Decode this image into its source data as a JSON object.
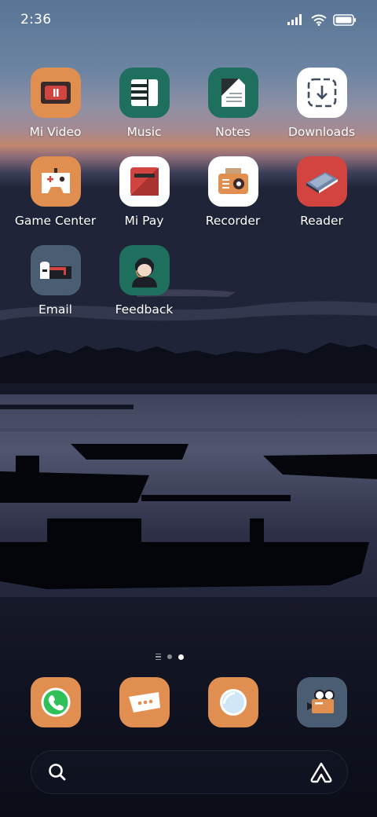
{
  "status_bar": {
    "time": "2:36",
    "icons": [
      "signal-icon",
      "wifi-icon",
      "battery-icon"
    ]
  },
  "apps": [
    {
      "label": "Mi Video",
      "icon": "mi-video-icon",
      "color": "#e08f50"
    },
    {
      "label": "Music",
      "icon": "music-icon",
      "color": "#1f6f5f"
    },
    {
      "label": "Notes",
      "icon": "notes-icon",
      "color": "#1f6f5f"
    },
    {
      "label": "Downloads",
      "icon": "downloads-icon",
      "color": "#ffffff"
    },
    {
      "label": "Game Center",
      "icon": "game-center-icon",
      "color": "#e08f50"
    },
    {
      "label": "Mi Pay",
      "icon": "mi-pay-icon",
      "color": "#ffffff"
    },
    {
      "label": "Recorder",
      "icon": "recorder-icon",
      "color": "#ffffff"
    },
    {
      "label": "Reader",
      "icon": "reader-icon",
      "color": "#d2443f"
    },
    {
      "label": "Email",
      "icon": "email-icon",
      "color": "#4b5d73"
    },
    {
      "label": "Feedback",
      "icon": "feedback-icon",
      "color": "#1f6f5f"
    }
  ],
  "page_indicator": {
    "pages": 2,
    "active_page": 2
  },
  "dock": [
    {
      "icon": "phone-icon",
      "color": "#e08f50"
    },
    {
      "icon": "messages-icon",
      "color": "#e08f50"
    },
    {
      "icon": "browser-icon",
      "color": "#e08f50"
    },
    {
      "icon": "camera-icon",
      "color": "#4b5d73"
    }
  ],
  "search_bar": {
    "icons": [
      "search-icon",
      "assistant-icon"
    ]
  }
}
